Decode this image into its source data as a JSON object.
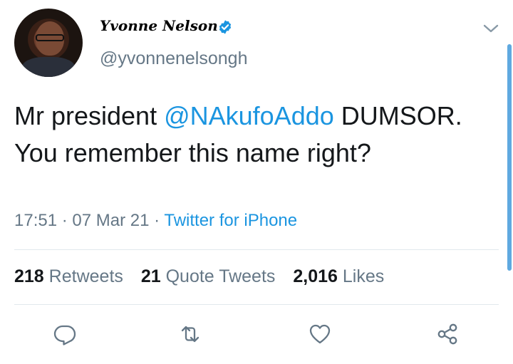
{
  "user": {
    "display_name": "Yvonne Nelson",
    "handle": "@yvonnenelsongh",
    "verified": true
  },
  "tweet": {
    "text_before": "Mr president ",
    "mention": "@NAkufoAddo",
    "text_after": " DUMSOR.  You remember this name right?",
    "time": "17:51",
    "date": "07 Mar 21",
    "separator": "·",
    "source": "Twitter for iPhone"
  },
  "stats": {
    "retweets_count": "218",
    "retweets_label": "Retweets",
    "quotes_count": "21",
    "quotes_label": "Quote Tweets",
    "likes_count": "2,016",
    "likes_label": "Likes"
  },
  "icons": {
    "reply": "reply-icon",
    "retweet": "retweet-icon",
    "like": "heart-icon",
    "share": "share-icon",
    "more": "chevron-down-icon",
    "verified": "verified-badge-icon"
  },
  "colors": {
    "accent": "#1b95e0",
    "secondary_text": "#657786",
    "primary_text": "#14171a"
  }
}
